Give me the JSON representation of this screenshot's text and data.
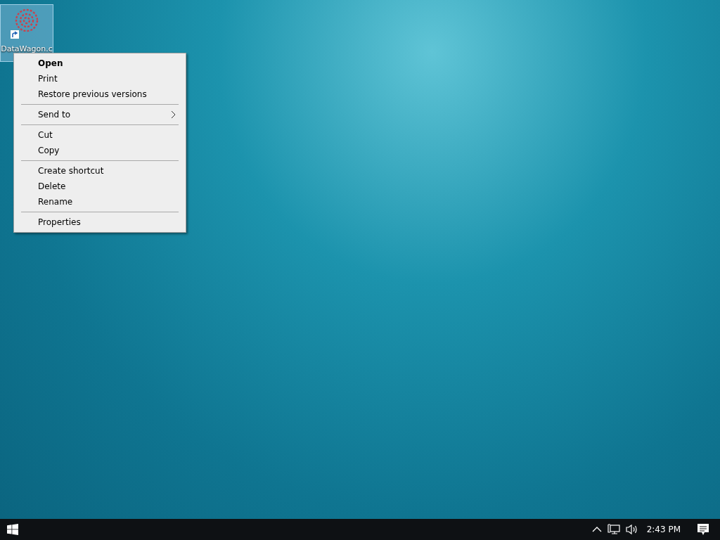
{
  "desktop": {
    "icons": [
      {
        "label": "DataWagon.c",
        "selected": true
      }
    ]
  },
  "context_menu": {
    "groups": [
      [
        {
          "label": "Open",
          "default": true,
          "submenu": false
        },
        {
          "label": "Print",
          "default": false,
          "submenu": false
        },
        {
          "label": "Restore previous versions",
          "default": false,
          "submenu": false
        }
      ],
      [
        {
          "label": "Send to",
          "default": false,
          "submenu": true
        }
      ],
      [
        {
          "label": "Cut",
          "default": false,
          "submenu": false
        },
        {
          "label": "Copy",
          "default": false,
          "submenu": false
        }
      ],
      [
        {
          "label": "Create shortcut",
          "default": false,
          "submenu": false
        },
        {
          "label": "Delete",
          "default": false,
          "submenu": false
        },
        {
          "label": "Rename",
          "default": false,
          "submenu": false
        }
      ],
      [
        {
          "label": "Properties",
          "default": false,
          "submenu": false
        }
      ]
    ]
  },
  "taskbar": {
    "clock": "2:43 PM"
  }
}
